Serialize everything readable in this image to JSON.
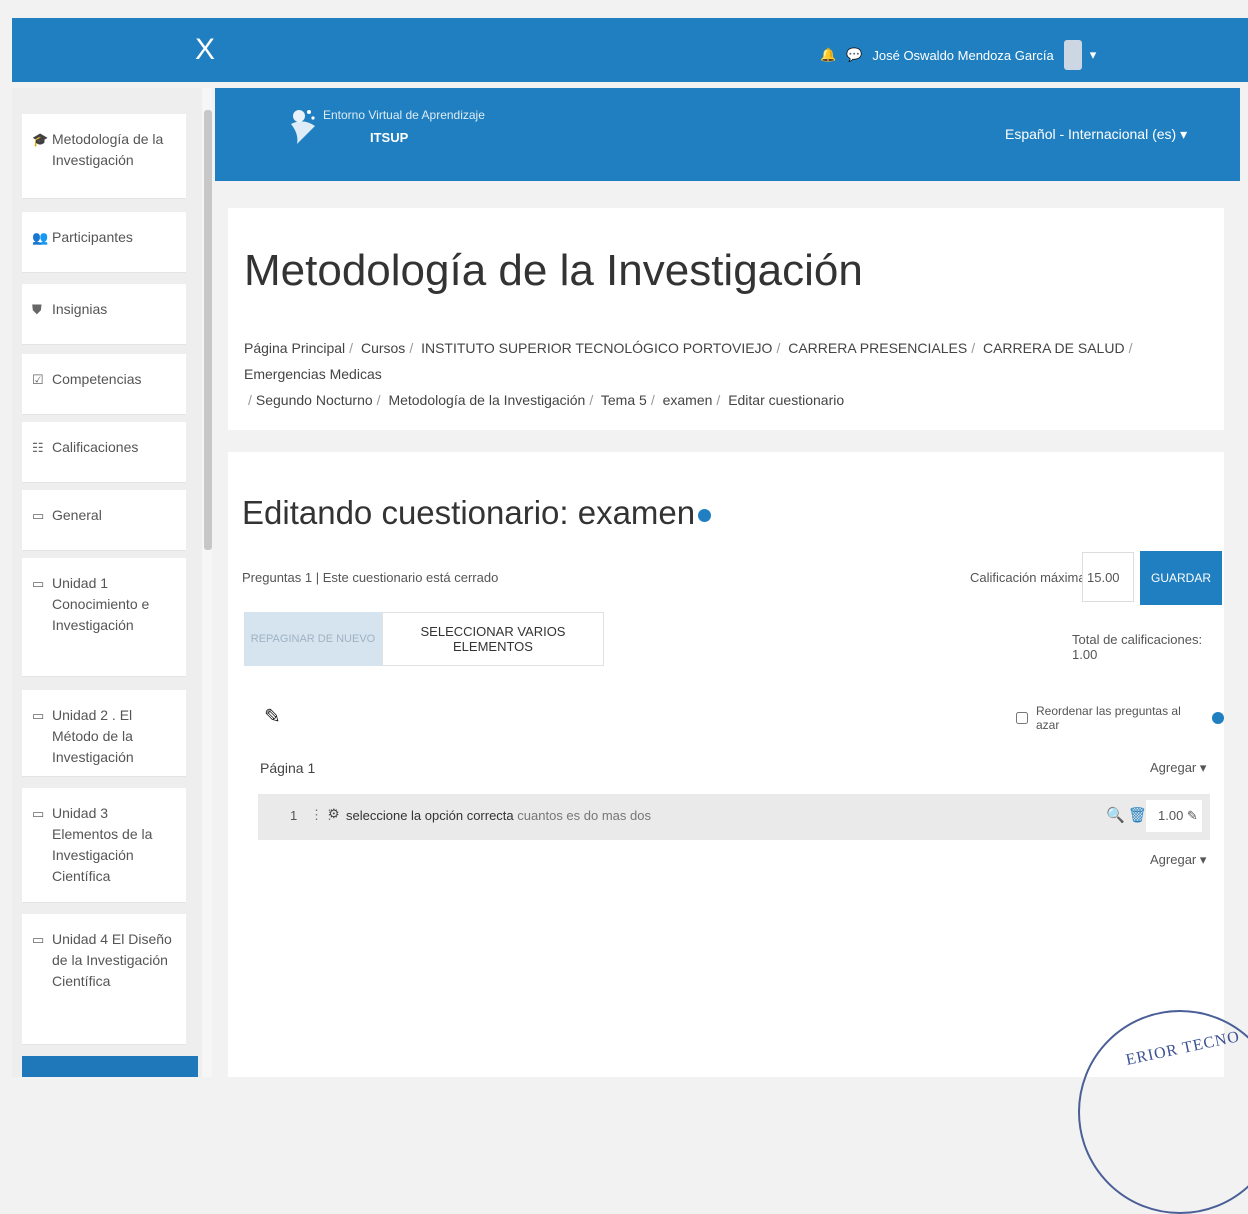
{
  "topbar": {
    "close_label": "X",
    "user_name": "José Oswaldo Mendoza García",
    "user_menu_caret": "▾"
  },
  "sidebar": {
    "items": [
      {
        "icon": "graduation-cap-icon",
        "glyph": "🎓",
        "label": "Metodología de la Investigación"
      },
      {
        "icon": "users-icon",
        "glyph": "👥",
        "label": "Participantes"
      },
      {
        "icon": "shield-icon",
        "glyph": "⛊",
        "label": "Insignias"
      },
      {
        "icon": "checkmark-icon",
        "glyph": "☑",
        "label": "Competencias"
      },
      {
        "icon": "table-icon",
        "glyph": "☷",
        "label": "Calificaciones"
      },
      {
        "icon": "folder-icon",
        "glyph": "▭",
        "label": "General"
      },
      {
        "icon": "folder-icon",
        "glyph": "▭",
        "label": "Unidad 1 Conocimiento e Investigación"
      },
      {
        "icon": "folder-icon",
        "glyph": "▭",
        "label": "Unidad 2 . El Método de la Investigación"
      },
      {
        "icon": "folder-icon",
        "glyph": "▭",
        "label": "Unidad 3 Elementos de la Investigación Científica"
      },
      {
        "icon": "folder-icon",
        "glyph": "▭",
        "label": "Unidad 4 El Diseño de la Investigación Científica"
      }
    ]
  },
  "header": {
    "logo_top": "Entorno Virtual de Aprendizaje",
    "logo_sub": "ITSUP",
    "language": "Español - Internacional (es) ▾"
  },
  "page": {
    "title": "Metodología de la Investigación",
    "breadcrumb": [
      "Página Principal",
      "Cursos",
      "INSTITUTO SUPERIOR TECNOLÓGICO PORTOVIEJO",
      "CARRERA PRESENCIALES",
      "CARRERA DE SALUD",
      "Emergencias Medicas",
      "Segundo Nocturno",
      "Metodología de la Investigación",
      "Tema 5",
      "examen",
      "Editar cuestionario"
    ]
  },
  "quiz": {
    "heading": "Editando cuestionario: examen",
    "info": "Preguntas 1 | Este cuestionario está cerrado",
    "max_grade_label": "Calificación máxima",
    "max_grade_value": "15.00",
    "save_label": "GUARDAR",
    "repaginate_label": "REPAGINAR DE NUEVO",
    "select_multiple_label": "SELECCIONAR VARIOS ELEMENTOS",
    "total_marks": "Total de calificaciones: 1.00",
    "shuffle_label": "Reordenar las preguntas al azar",
    "page_label": "Página 1",
    "add_label": "Agregar ▾",
    "questions": [
      {
        "number": "1",
        "text": "seleccione la opción correcta",
        "text_tail": "cuantos es do mas dos",
        "mark": "1.00"
      }
    ]
  },
  "stamp": {
    "text": "ERIOR TECNO"
  },
  "colors": {
    "brand": "#1f7fc0",
    "panel": "#ffffff",
    "background": "#f2f2f2"
  }
}
